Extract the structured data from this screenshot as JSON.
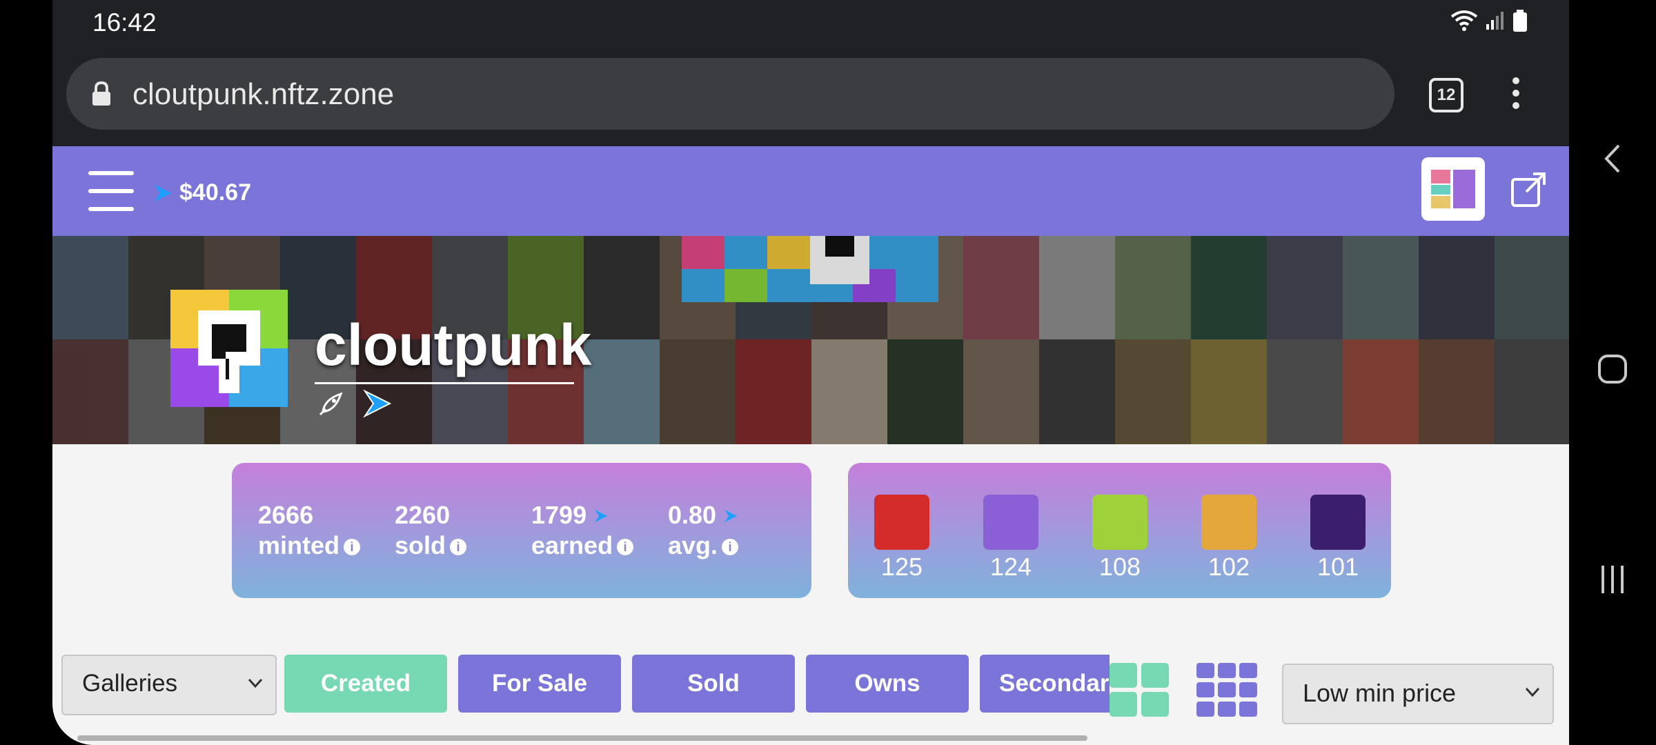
{
  "status_bar": {
    "time": "16:42"
  },
  "browser": {
    "url": "cloutpunk.nftz.zone",
    "tab_count": "12"
  },
  "site_header": {
    "balance": "$40.67"
  },
  "collection": {
    "name": "cloutpunk"
  },
  "stats": [
    {
      "value": "2666",
      "label": "minted",
      "coin": false
    },
    {
      "value": "2260",
      "label": "sold",
      "coin": false
    },
    {
      "value": "1799",
      "label": "earned",
      "coin": true
    },
    {
      "value": "0.80",
      "label": "avg.",
      "coin": true
    }
  ],
  "top_tokens": [
    {
      "number": "125",
      "bg": "#d42b2b"
    },
    {
      "number": "124",
      "bg": "#8b5fd6"
    },
    {
      "number": "108",
      "bg": "#9fd23a"
    },
    {
      "number": "102",
      "bg": "#e3a73c"
    },
    {
      "number": "101",
      "bg": "#3b1f6e"
    }
  ],
  "filters": {
    "galleries_select": "Galleries",
    "tabs": [
      "Created",
      "For Sale",
      "Sold",
      "Owns",
      "Secondar"
    ],
    "active_tab": "Created",
    "sort_select": "Low min price"
  },
  "colors": {
    "header": "#7b74d9",
    "active_tab": "#76d9b3",
    "tab": "#7b74d9",
    "coin_blue": "#1e90ff"
  }
}
